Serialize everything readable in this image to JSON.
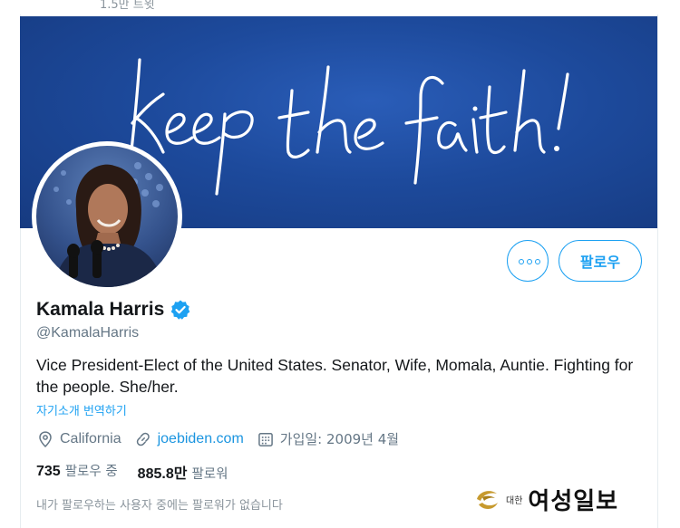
{
  "top": {
    "tweet_count": "1.5만 트윗"
  },
  "banner": {
    "script_text": "keep the faith!"
  },
  "profile": {
    "name": "Kamala Harris",
    "handle": "@KamalaHarris",
    "bio": "Vice President-Elect of the United States. Senator, Wife, Momala, Auntie. Fighting for the people. She/her.",
    "translate_label": "자기소개 번역하기",
    "location": "California",
    "website": "joebiden.com",
    "joined": "가입일: 2009년 4월",
    "following_count": "735",
    "following_label": "팔로우 중",
    "followers_count": "885.8만",
    "followers_label": "팔로워",
    "mutual_note": "내가 팔로우하는 사용자 중에는 팔로워가 없습니다"
  },
  "actions": {
    "follow_label": "팔로우"
  },
  "icons": {
    "more": "more-options-icon",
    "verified": "verified-badge-icon",
    "location": "location-pin-icon",
    "link": "link-icon",
    "calendar": "calendar-icon"
  },
  "colors": {
    "accent": "#1da1f2",
    "banner": "#1d4a9c",
    "text_secondary": "#657786"
  },
  "watermark": {
    "small": "대한",
    "big": "여성일보"
  }
}
